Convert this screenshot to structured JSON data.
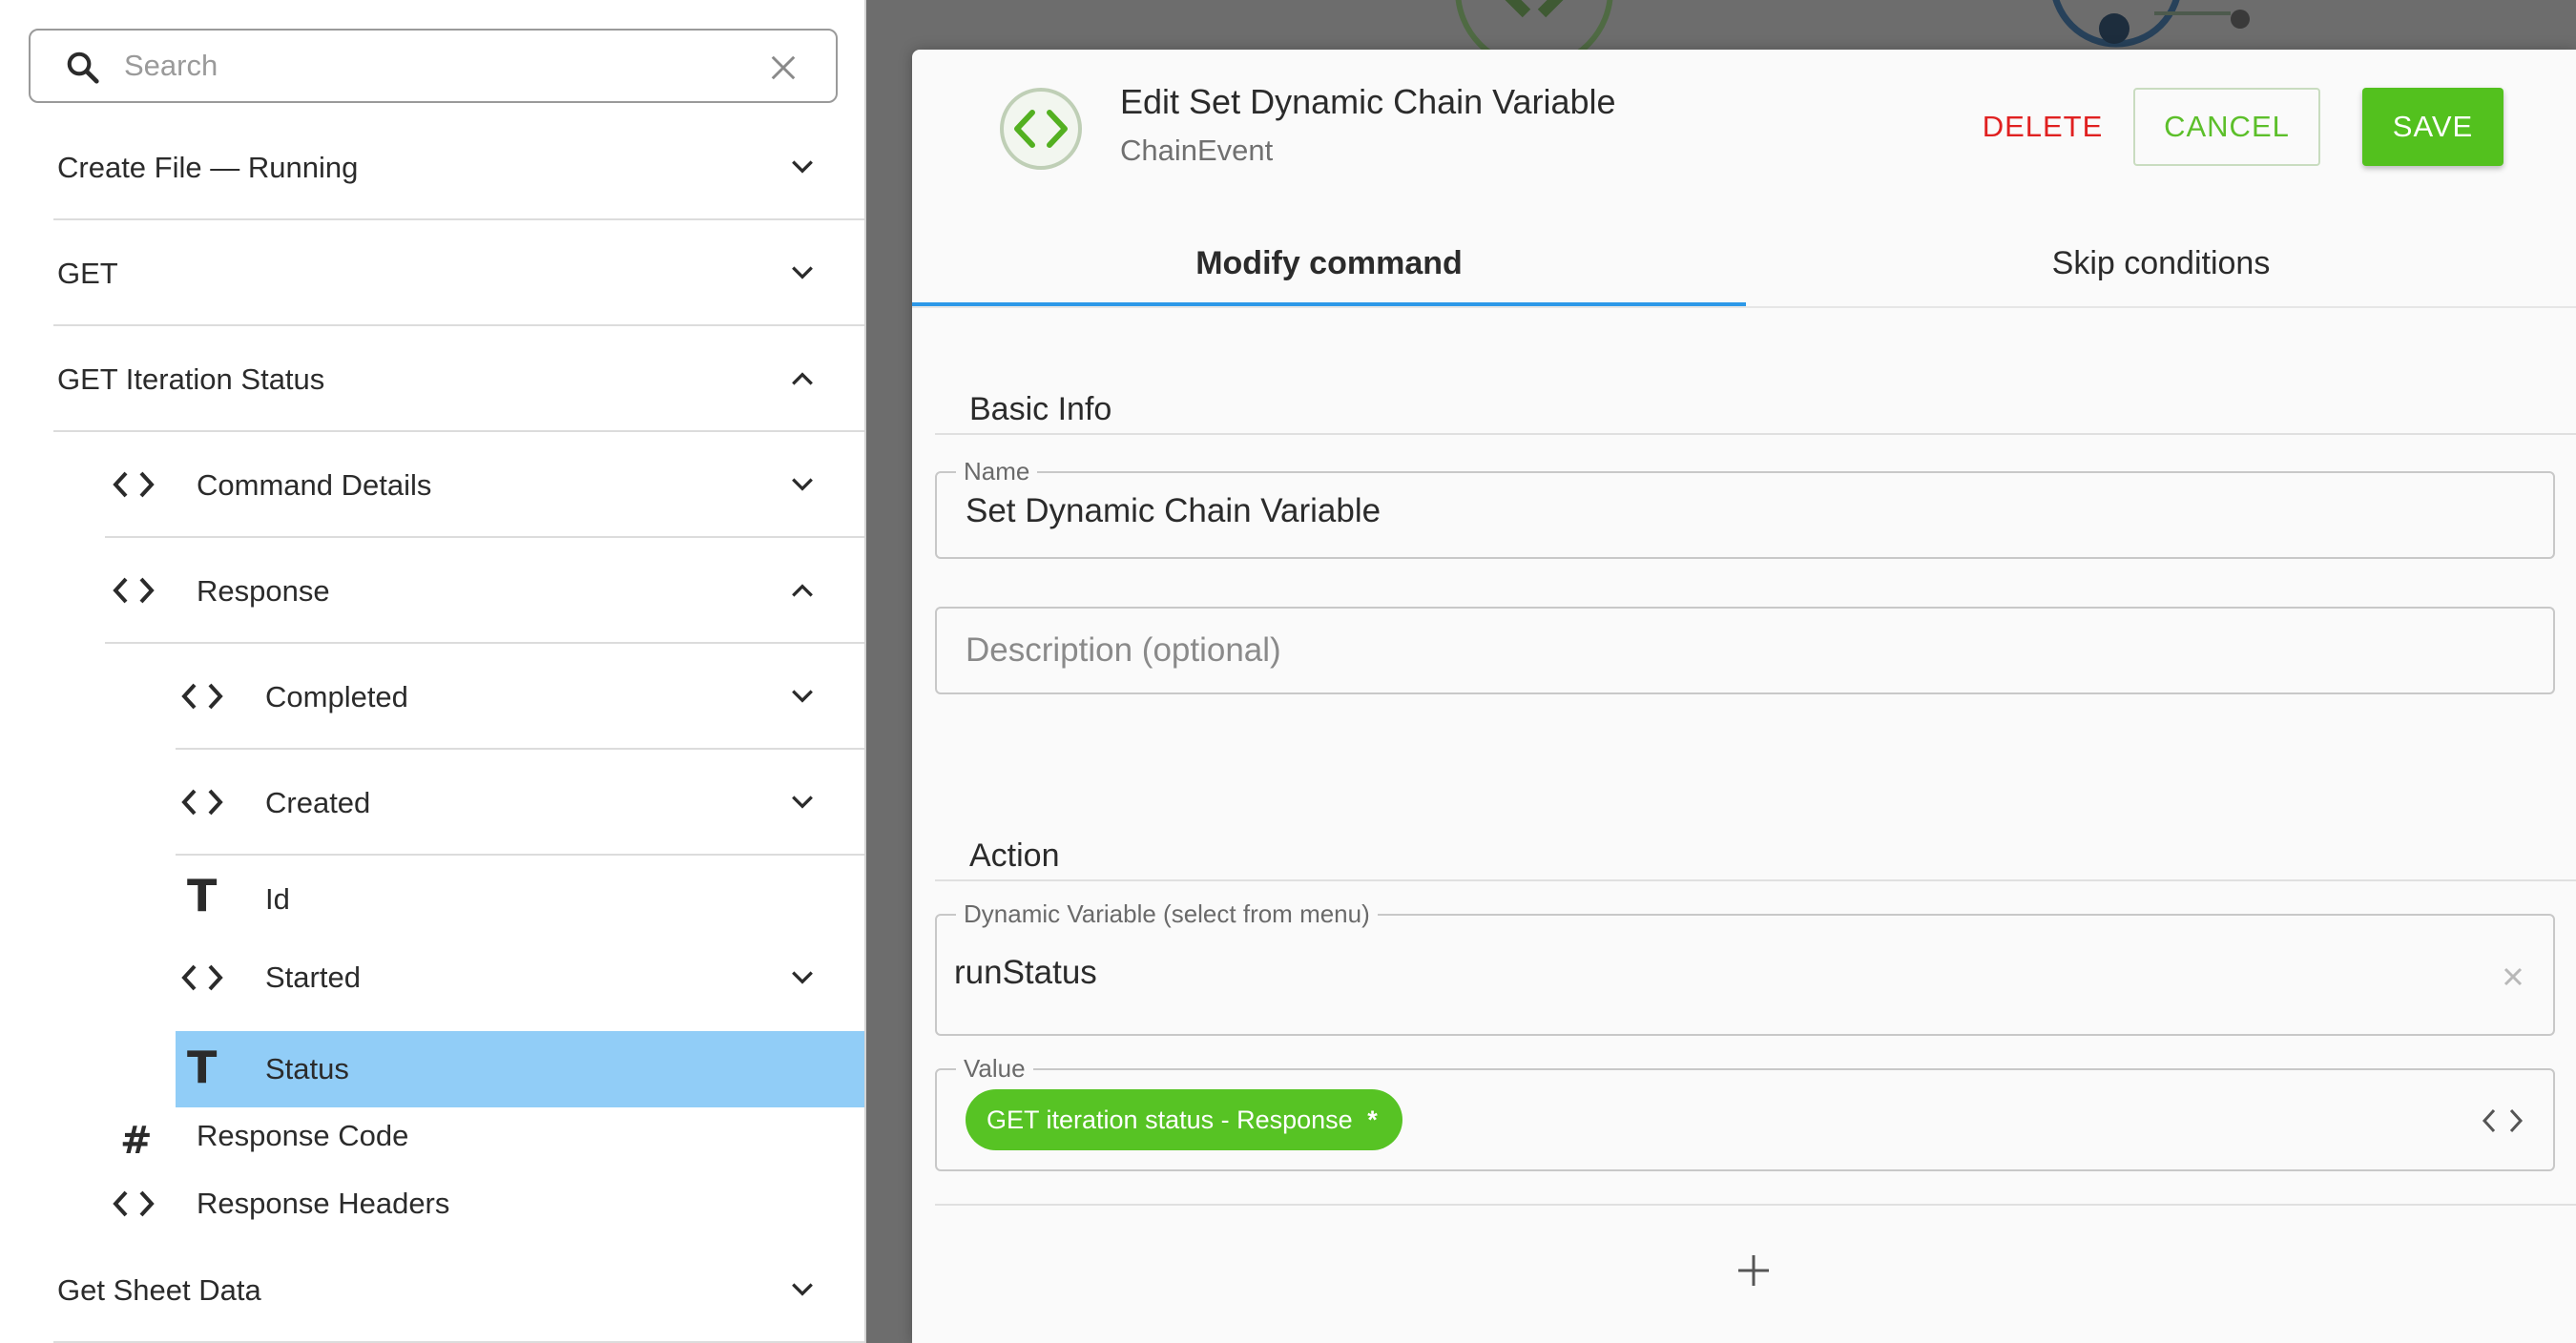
{
  "search": {
    "placeholder": "Search"
  },
  "tree": [
    {
      "label": "Create File — Running",
      "state": "collapsed"
    },
    {
      "label": "GET",
      "state": "collapsed"
    },
    {
      "label": "GET Iteration Status",
      "state": "expanded"
    },
    {
      "label": "Command Details",
      "icon": "code-icon",
      "state": "collapsed"
    },
    {
      "label": "Response",
      "icon": "code-icon",
      "state": "expanded"
    },
    {
      "label": "Completed",
      "icon": "code-icon",
      "state": "collapsed"
    },
    {
      "label": "Created",
      "icon": "code-icon",
      "state": "collapsed"
    },
    {
      "label": "Id",
      "icon": "text-type-icon"
    },
    {
      "label": "Started",
      "icon": "code-icon",
      "state": "collapsed"
    },
    {
      "label": "Status",
      "icon": "text-type-icon",
      "selected": true
    },
    {
      "label": "Response Code",
      "icon": "number-type-icon"
    },
    {
      "label": "Response Headers",
      "icon": "code-icon"
    },
    {
      "label": "Get Sheet Data",
      "state": "collapsed"
    }
  ],
  "modal": {
    "title": "Edit Set Dynamic Chain Variable",
    "subtitle": "ChainEvent",
    "delete_label": "DELETE",
    "cancel_label": "CANCEL",
    "save_label": "SAVE",
    "tabs": [
      "Modify command",
      "Skip conditions"
    ],
    "basic_info": {
      "heading": "Basic Info",
      "name_label": "Name",
      "name_value": "Set Dynamic Chain Variable",
      "description_placeholder": "Description (optional)"
    },
    "action": {
      "heading": "Action",
      "dynamic_variable_label": "Dynamic Variable (select from menu)",
      "dynamic_variable_value": "runStatus",
      "value_label": "Value",
      "value_chip": "GET iteration status - Response"
    }
  },
  "colors": {
    "accent_green": "#53c11e",
    "delete_red": "#e02020",
    "tab_indicator": "#2c98e8",
    "selected_row": "#91cdf7"
  }
}
